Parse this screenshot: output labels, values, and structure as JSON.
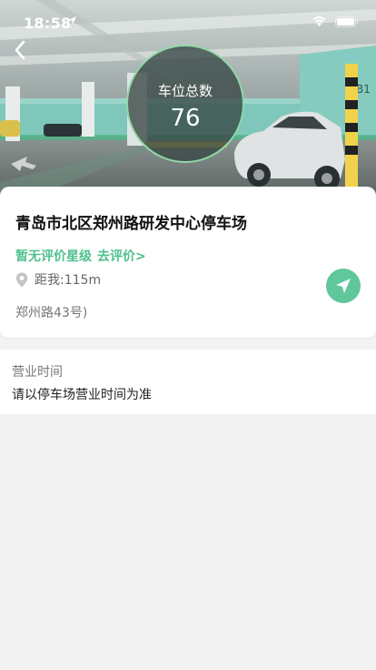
{
  "status_bar": {
    "time": "18:58"
  },
  "hero": {
    "count_label": "车位总数",
    "count_value": "76",
    "level_sign": "B1"
  },
  "lot": {
    "name": "青岛市北区郑州路研发中心停车场",
    "rating_status": "暂无评价星级",
    "rate_link": "去评价>",
    "distance": "距我:115m",
    "address": "郑州路43号)"
  },
  "hours": {
    "label": "营业时间",
    "value": "请以停车场营业时间为准"
  },
  "icons": {
    "back": "back-chevron-icon",
    "location_pin": "location-pin-icon",
    "navigate": "navigate-arrow-icon"
  },
  "colors": {
    "accent": "#4fc08d",
    "nav_button": "#5fc79a",
    "circle_border": "#8fd9a8"
  }
}
